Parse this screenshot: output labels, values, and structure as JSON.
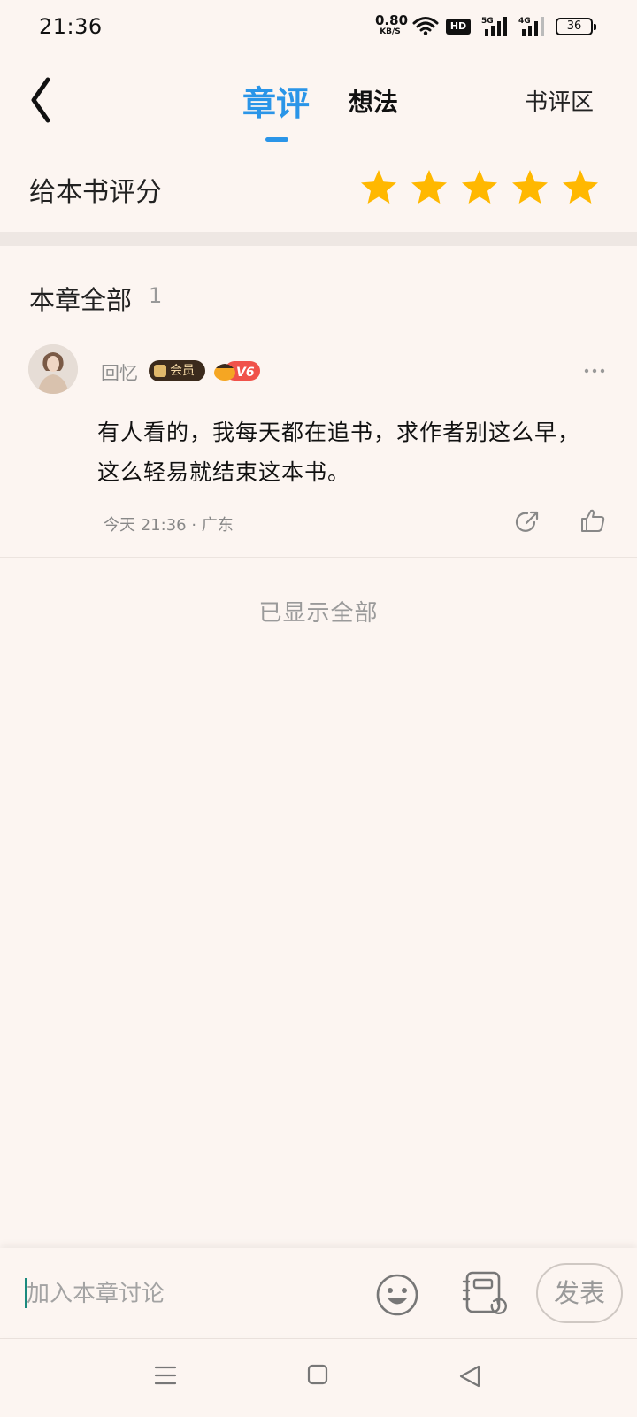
{
  "status_bar": {
    "time": "21:36",
    "net_speed_value": "0.80",
    "net_speed_unit": "KB/S",
    "hd_label": "HD",
    "sig1_label": "5G",
    "sig2_label": "4G",
    "battery_level": "36"
  },
  "header": {
    "tab_chapter": "章评",
    "tab_ideas": "想法",
    "book_review": "书评区",
    "active_color": "#2A95E8"
  },
  "rating": {
    "label": "给本书评分",
    "stars": 5,
    "max": 5,
    "star_color": "#FFB800"
  },
  "section": {
    "title": "本章全部",
    "count": "1"
  },
  "comment": {
    "username": "回忆",
    "vip_label": "会员",
    "level": "V6",
    "text": "有人看的，我每天都在追书，求作者别这么早，这么轻易就结束这本书。",
    "meta": "今天 21:36 · 广东"
  },
  "footer_text": "已显示全部",
  "input_bar": {
    "placeholder": "加入本章讨论",
    "publish_label": "发表"
  }
}
